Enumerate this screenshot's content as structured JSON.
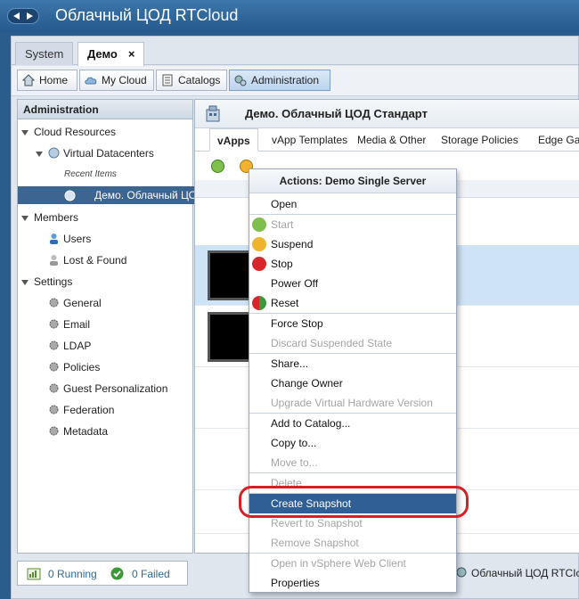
{
  "app": {
    "title": "Облачный ЦОД RTCloud"
  },
  "window_tabs": [
    {
      "label": "System"
    },
    {
      "label": "Демо",
      "close": "×"
    }
  ],
  "toolbar": {
    "home": "Home",
    "my_cloud": "My Cloud",
    "catalogs": "Catalogs",
    "administration": "Administration"
  },
  "sidebar": {
    "header": "Administration",
    "cloud_resources": "Cloud Resources",
    "virtual_datacenters": "Virtual Datacenters",
    "recent_items": "Recent Items",
    "selected_vdc": "Демо. Облачный ЦОД",
    "members": "Members",
    "users": "Users",
    "lost_found": "Lost & Found",
    "settings": "Settings",
    "settings_items": [
      "General",
      "Email",
      "LDAP",
      "Policies",
      "Guest Personalization",
      "Federation",
      "Metadata"
    ]
  },
  "main": {
    "title": "Демо. Облачный ЦОД Стандарт",
    "tabs": [
      "vApps",
      "vApp Templates",
      "Media & Other",
      "Storage Policies",
      "Edge Ga"
    ]
  },
  "status": {
    "running": "0 Running",
    "failed": "0 Failed",
    "right": "Облачный ЦОД RTCIo"
  },
  "context_menu": {
    "header": "Actions:  Demo Single Server",
    "items": [
      {
        "label": "Open",
        "enabled": true
      },
      {
        "label": "Start",
        "enabled": false
      },
      {
        "label": "Suspend",
        "enabled": true
      },
      {
        "label": "Stop",
        "enabled": true
      },
      {
        "label": "Power Off",
        "enabled": true
      },
      {
        "label": "Reset",
        "enabled": true
      },
      {
        "label": "Force Stop",
        "enabled": true
      },
      {
        "label": "Discard Suspended State",
        "enabled": false
      },
      {
        "label": "Share...",
        "enabled": true
      },
      {
        "label": "Change Owner",
        "enabled": true
      },
      {
        "label": "Upgrade Virtual Hardware Version",
        "enabled": false
      },
      {
        "label": "Add to Catalog...",
        "enabled": true
      },
      {
        "label": "Copy to...",
        "enabled": true
      },
      {
        "label": "Move to...",
        "enabled": false
      },
      {
        "label": "Delete",
        "enabled": false
      },
      {
        "label": "Create Snapshot",
        "enabled": true,
        "highlighted": true
      },
      {
        "label": "Revert to Snapshot",
        "enabled": false
      },
      {
        "label": "Remove Snapshot",
        "enabled": false
      },
      {
        "label": "Open in vSphere Web Client",
        "enabled": false
      },
      {
        "label": "Properties",
        "enabled": true
      }
    ]
  },
  "colors": {
    "title_bar": "#2f6699",
    "selection": "#2f5f95",
    "highlight_ring": "#d61f26",
    "start_icon": "#5aa52a",
    "suspend_icon": "#f0a81e",
    "stop_icon": "#d8262a"
  }
}
